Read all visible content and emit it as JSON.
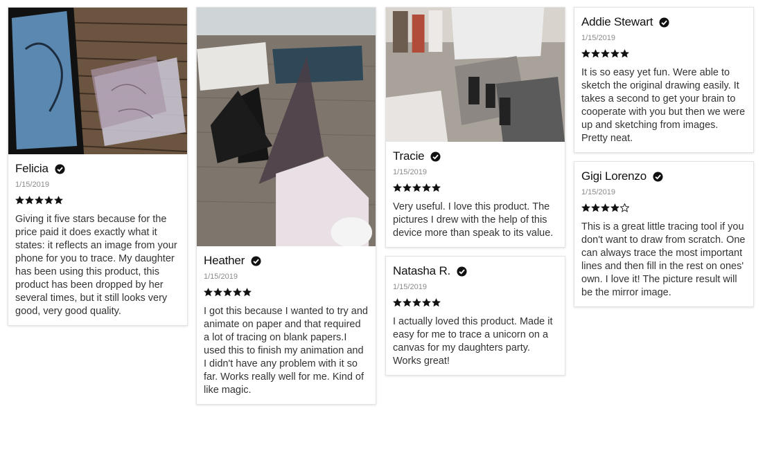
{
  "reviews": [
    {
      "name": "Felicia",
      "date": "1/15/2019",
      "rating": 5,
      "text": "Giving it five stars because for the price paid it does exactly what it states: it reflects an image from your phone for you to trace. My daughter has been using this product, this product has been dropped by her several times, but it still looks very good, very good quality."
    },
    {
      "name": "Heather",
      "date": "1/15/2019",
      "rating": 5,
      "text": "I got this because I wanted to try and animate on paper and that required a lot of tracing on blank papers.I used this to finish my animation and I didn't have any problem with it so far. Works really well for me. Kind of like magic."
    },
    {
      "name": "Tracie",
      "date": "1/15/2019",
      "rating": 5,
      "text": "Very useful. I love this product. The pictures I drew with the help of this device more than speak to its value."
    },
    {
      "name": "Natasha R.",
      "date": "1/15/2019",
      "rating": 5,
      "text": "I actually loved this product. Made it easy for me to trace a unicorn on a canvas for my daughters party. Works great!"
    },
    {
      "name": "Addie Stewart",
      "date": "1/15/2019",
      "rating": 5,
      "text": "It is so easy yet fun. Were able to sketch the original drawing easily. It takes a second to get your brain to cooperate with you but then we were up and sketching from images. Pretty neat."
    },
    {
      "name": "Gigi Lorenzo",
      "date": "1/15/2019",
      "rating": 4,
      "text": "This is a great little tracing tool if you don't want to draw from scratch. One can always trace the most important lines and then fill in the rest on ones' own. I love it! The picture result will be the mirror image."
    }
  ],
  "colors": {
    "star": "#111111",
    "verified": "#111111",
    "date": "#8a8a8a",
    "border": "#e3e3e3"
  },
  "icons": {
    "verified": "check-circle-icon",
    "star_filled": "star-filled-icon",
    "star_empty": "star-outline-icon"
  }
}
